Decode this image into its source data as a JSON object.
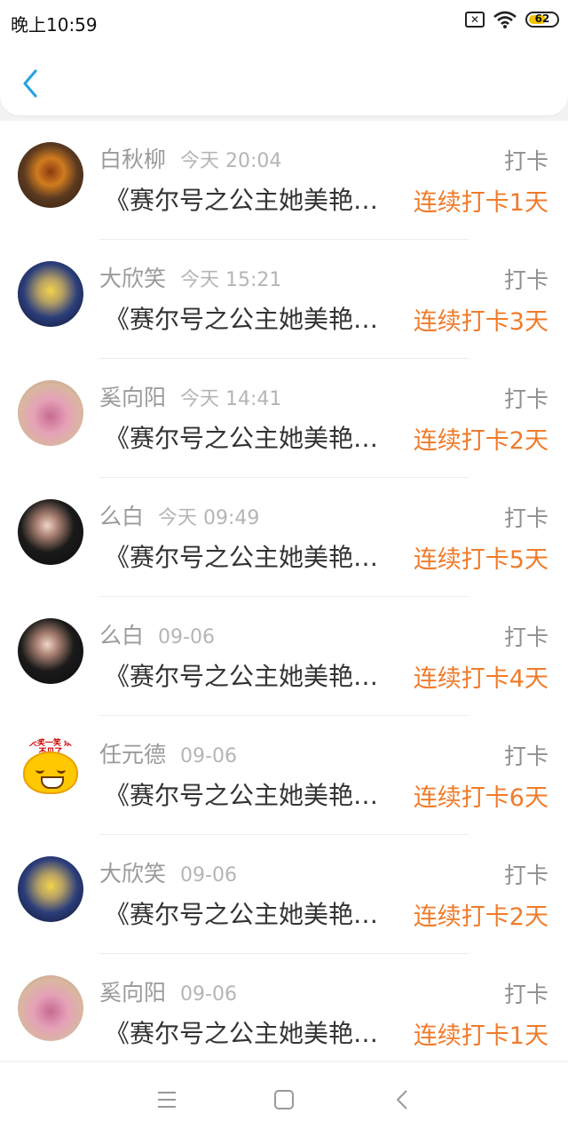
{
  "status_bar": {
    "time": "晚上10:59",
    "battery": "62",
    "battery_level": 0.62,
    "icons": [
      "sim-x-icon",
      "wifi-icon",
      "battery-icon"
    ]
  },
  "header": {
    "back_icon": "chevron-left-icon",
    "accent": "#2aa3e0"
  },
  "entries": [
    {
      "name": "白秋柳",
      "time": "今天 20:04",
      "action": "打卡",
      "title": "《赛尔号之公主她美艳…",
      "streak": "连续打卡1天"
    },
    {
      "name": "大欣笑",
      "time": "今天 15:21",
      "action": "打卡",
      "title": "《赛尔号之公主她美艳…",
      "streak": "连续打卡3天"
    },
    {
      "name": "奚向阳",
      "time": "今天 14:41",
      "action": "打卡",
      "title": "《赛尔号之公主她美艳…",
      "streak": "连续打卡2天"
    },
    {
      "name": "么白",
      "time": "今天 09:49",
      "action": "打卡",
      "title": "《赛尔号之公主她美艳…",
      "streak": "连续打卡5天"
    },
    {
      "name": "么白",
      "time": "09-06",
      "action": "打卡",
      "title": "《赛尔号之公主她美艳…",
      "streak": "连续打卡4天"
    },
    {
      "name": "任元德",
      "time": "09-06",
      "action": "打卡",
      "title": "《赛尔号之公主她美艳…",
      "streak": "连续打卡6天"
    },
    {
      "name": "大欣笑",
      "time": "09-06",
      "action": "打卡",
      "title": "《赛尔号之公主她美艳…",
      "streak": "连续打卡2天"
    },
    {
      "name": "奚向阳",
      "time": "09-06",
      "action": "打卡",
      "title": "《赛尔号之公主她美艳…",
      "streak": "连续打卡1天"
    }
  ],
  "avatar_sticker_text": "今天笑一笑 烦恼不见了",
  "nav": {
    "items": [
      "menu-icon",
      "home-square-icon",
      "back-triangle-icon"
    ]
  },
  "colors": {
    "streak": "#f07b2a",
    "name": "#9a9a9a",
    "title": "#333333"
  }
}
